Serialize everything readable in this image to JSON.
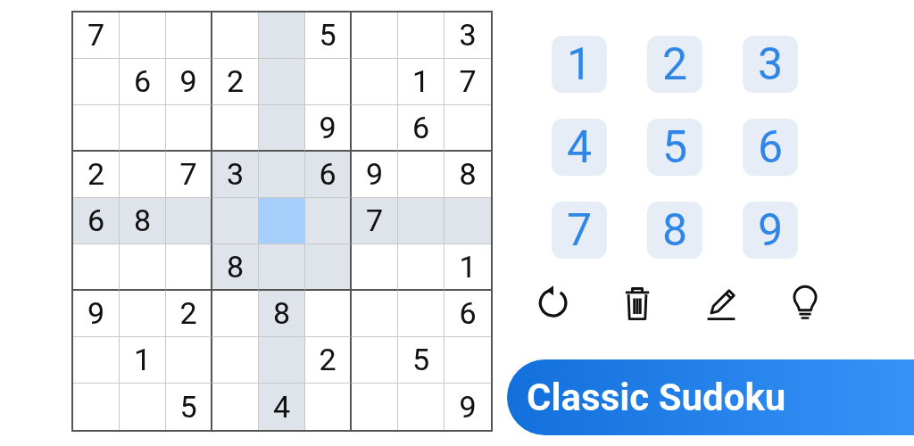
{
  "grid": {
    "rows": [
      [
        {
          "value": "7",
          "selected": false
        },
        {
          "selected": false
        },
        {
          "selected": false
        },
        {
          "selected": false
        },
        {
          "selected": false
        },
        {
          "value": "5",
          "selected": false
        },
        {
          "selected": false
        },
        {
          "selected": false
        },
        {
          "value": "3",
          "selected": false
        }
      ],
      [
        {
          "selected": false
        },
        {
          "value": "6",
          "selected": false
        },
        {
          "value": "9",
          "selected": false
        },
        {
          "value": "2",
          "selected": false
        },
        {
          "selected": false
        },
        {
          "selected": false
        },
        {
          "selected": false
        },
        {
          "value": "1",
          "selected": false
        },
        {
          "value": "7",
          "selected": false
        }
      ],
      [
        {
          "selected": false
        },
        {
          "selected": false
        },
        {
          "selected": false
        },
        {
          "selected": false
        },
        {
          "selected": false
        },
        {
          "value": "9",
          "selected": false
        },
        {
          "selected": false
        },
        {
          "value": "6",
          "selected": false
        },
        {
          "selected": false
        }
      ],
      [
        {
          "value": "2",
          "selected": false
        },
        {
          "selected": false
        },
        {
          "value": "7",
          "selected": false
        },
        {
          "value": "3",
          "selected": false
        },
        {
          "selected": false
        },
        {
          "value": "6",
          "selected": false
        },
        {
          "value": "9",
          "selected": false
        },
        {
          "selected": false
        },
        {
          "value": "8",
          "selected": false
        }
      ],
      [
        {
          "value": "6",
          "selected": false
        },
        {
          "value": "8",
          "selected": false
        },
        {
          "selected": false
        },
        {
          "selected": false
        },
        {
          "selected": true
        },
        {
          "selected": false
        },
        {
          "value": "7",
          "selected": false
        },
        {
          "selected": false
        },
        {
          "selected": false
        }
      ],
      [
        {
          "selected": false
        },
        {
          "selected": false
        },
        {
          "selected": false
        },
        {
          "value": "8",
          "selected": false
        },
        {
          "selected": false
        },
        {
          "selected": false
        },
        {
          "selected": false
        },
        {
          "selected": false
        },
        {
          "value": "1",
          "selected": false
        }
      ],
      [
        {
          "value": "9",
          "selected": false
        },
        {
          "selected": false
        },
        {
          "value": "2",
          "selected": false
        },
        {
          "selected": false
        },
        {
          "value": "8",
          "selected": false
        },
        {
          "selected": false
        },
        {
          "selected": false
        },
        {
          "selected": false
        },
        {
          "value": "6",
          "selected": false
        }
      ],
      [
        {
          "selected": false
        },
        {
          "value": "1",
          "selected": false
        },
        {
          "selected": false
        },
        {
          "selected": false
        },
        {
          "selected": false
        },
        {
          "value": "2",
          "selected": false
        },
        {
          "selected": false
        },
        {
          "value": "5",
          "selected": false
        },
        {
          "selected": false
        }
      ],
      [
        {
          "selected": false
        },
        {
          "selected": false
        },
        {
          "value": "5",
          "selected": false
        },
        {
          "selected": false
        },
        {
          "value": "4",
          "selected": false
        },
        {
          "selected": false
        },
        {
          "selected": false
        },
        {
          "selected": false
        },
        {
          "value": "9",
          "selected": false
        }
      ]
    ]
  },
  "number_pad": [
    "1",
    "2",
    "3",
    "4",
    "5",
    "6",
    "7",
    "8",
    "9"
  ],
  "tools": [
    {
      "kind": "undo"
    },
    {
      "kind": "erase"
    },
    {
      "kind": "notes"
    },
    {
      "kind": "hint"
    }
  ],
  "banner": {
    "title": "Classic Sudoku"
  }
}
